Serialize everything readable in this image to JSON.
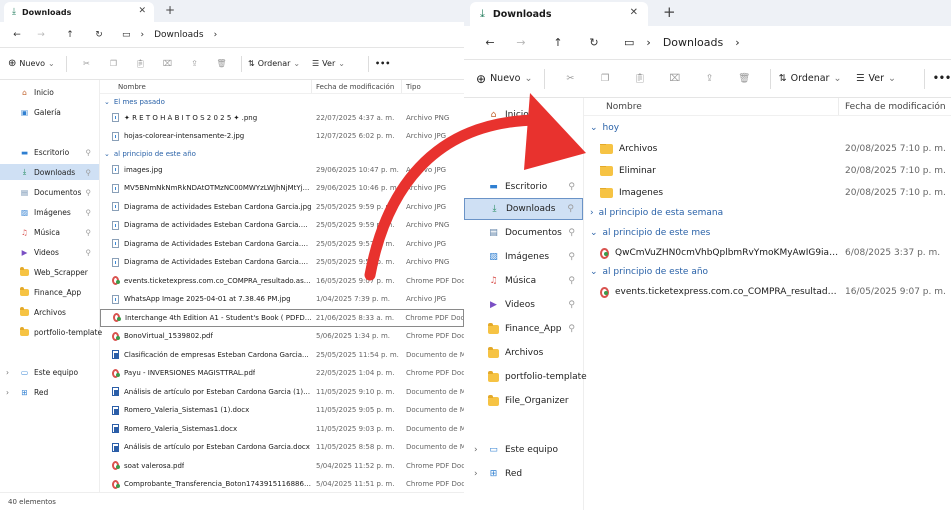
{
  "colors": {
    "accent": "#2a62a8",
    "selection": "#cfe0f4",
    "arrow": "#e8322e",
    "folder": "#f6c344"
  },
  "left": {
    "tab": {
      "title": "Downloads"
    },
    "breadcrumb": [
      "Downloads"
    ],
    "toolbar": {
      "new": "Nuevo",
      "sort": "Ordenar",
      "view": "Ver",
      "more": "•••"
    },
    "sidebar": [
      {
        "label": "Inicio",
        "icon": "home-icon"
      },
      {
        "label": "Galería",
        "icon": "gallery-icon"
      },
      {
        "label": "Escritorio",
        "icon": "desktop-icon",
        "pinned": true
      },
      {
        "label": "Downloads",
        "icon": "download-icon",
        "pinned": true,
        "selected": true
      },
      {
        "label": "Documentos",
        "icon": "documents-icon",
        "pinned": true
      },
      {
        "label": "Imágenes",
        "icon": "pictures-icon",
        "pinned": true
      },
      {
        "label": "Música",
        "icon": "music-icon",
        "pinned": true
      },
      {
        "label": "Videos",
        "icon": "videos-icon",
        "pinned": true
      },
      {
        "label": "Web_Scrapper",
        "icon": "folder-icon"
      },
      {
        "label": "Finance_App",
        "icon": "folder-icon"
      },
      {
        "label": "Archivos",
        "icon": "folder-icon"
      },
      {
        "label": "portfolio-template",
        "icon": "folder-icon"
      },
      {
        "label": "Este equipo",
        "icon": "computer-icon"
      },
      {
        "label": "Red",
        "icon": "network-icon"
      }
    ],
    "columns": {
      "name": "Nombre",
      "date": "Fecha de modificación",
      "type": "Tipo"
    },
    "groups": [
      {
        "label": "El mes pasado",
        "rows": [
          {
            "name": "✦ R E T O H Á B I T O S 2 0 2 5 ✦ .png",
            "date": "22/07/2025 4:37 a. m.",
            "type": "Archivo PNG",
            "kind": "img"
          },
          {
            "name": "hojas-colorear-intensamente-2.jpg",
            "date": "12/07/2025 6:02 p. m.",
            "type": "Archivo JPG",
            "kind": "img"
          }
        ]
      },
      {
        "label": "al principio de este año",
        "rows": [
          {
            "name": "images.jpg",
            "date": "29/06/2025 10:47 p. m.",
            "type": "Archivo JPG",
            "kind": "img"
          },
          {
            "name": "MV5BNmNkNmRkNDAtOTMzNC00MWYzLWJhNjMtYj...",
            "date": "29/06/2025 10:46 p. m.",
            "type": "Archivo JPG",
            "kind": "img"
          },
          {
            "name": "Diagrama de actividades Esteban Cardona Garcia.jpg",
            "date": "25/05/2025 9:59 p. m.",
            "type": "Archivo JPG",
            "kind": "img"
          },
          {
            "name": "Diagrama de actividades Esteban Cardona Garcia.drawio.png",
            "date": "25/05/2025 9:59 p. m.",
            "type": "Archivo PNG",
            "kind": "img"
          },
          {
            "name": "Diagrama de Actividades Esteban Cardona Garcia.drawio.jpg",
            "date": "25/05/2025 9:57 p. m.",
            "type": "Archivo JPG",
            "kind": "img"
          },
          {
            "name": "Diagrama de Actividades Esteban Cardona Garcia.drawio.png",
            "date": "25/05/2025 9:56 p. m.",
            "type": "Archivo PNG",
            "kind": "img"
          },
          {
            "name": "events.ticketexpress.com.co_COMPRA_resultado.aspx_...",
            "date": "16/05/2025 9:07 p. m.",
            "type": "Chrome PDF Document",
            "kind": "pdf"
          },
          {
            "name": "WhatsApp Image 2025-04-01 at 7.38.46 PM.jpg",
            "date": "1/04/2025 7:39 p. m.",
            "type": "Archivo JPG",
            "kind": "img"
          },
          {
            "name": "Interchange 4th Edition A1 - Student's Book ( PDFDriv...",
            "date": "21/06/2025 8:33 a. m.",
            "type": "Chrome PDF Document",
            "kind": "pdf",
            "selected": true
          },
          {
            "name": "BonoVirtual_1539802.pdf",
            "date": "5/06/2025 1:34 p. m.",
            "type": "Chrome PDF Document",
            "kind": "pdf"
          },
          {
            "name": "Clasificación de empresas Esteban Cardona Garcia...",
            "date": "25/05/2025 11:54 p. m.",
            "type": "Documento de Microsoft Word",
            "kind": "doc"
          },
          {
            "name": "Payu - INVERSIONES MAGISTTRAL.pdf",
            "date": "22/05/2025 1:04 p. m.",
            "type": "Chrome PDF Document",
            "kind": "pdf"
          },
          {
            "name": "Análisis de artículo por Esteban Cardona Garcia (1).do...",
            "date": "11/05/2025 9:10 p. m.",
            "type": "Documento de Microsoft Word",
            "kind": "doc"
          },
          {
            "name": "Romero_Valeria_Sistemas1 (1).docx",
            "date": "11/05/2025 9:05 p. m.",
            "type": "Documento de Microsoft Word",
            "kind": "doc"
          },
          {
            "name": "Romero_Valeria_Sistemas1.docx",
            "date": "11/05/2025 9:03 p. m.",
            "type": "Documento de Microsoft Word",
            "kind": "doc"
          },
          {
            "name": "Análisis de artículo por Esteban Cardona Garcia.docx",
            "date": "11/05/2025 8:58 p. m.",
            "type": "Documento de Microsoft Word",
            "kind": "doc"
          },
          {
            "name": "soat valerosa.pdf",
            "date": "5/04/2025 11:52 p. m.",
            "type": "Chrome PDF Document",
            "kind": "pdf"
          },
          {
            "name": "Comprobante_Transferencia_Boton1743915116886.pdf",
            "date": "5/04/2025 11:51 p. m.",
            "type": "Chrome PDF Document",
            "kind": "pdf"
          }
        ]
      }
    ],
    "status": "40 elementos"
  },
  "right": {
    "tab": {
      "title": "Downloads"
    },
    "breadcrumb": [
      "Downloads"
    ],
    "toolbar": {
      "new": "Nuevo",
      "sort": "Ordenar",
      "view": "Ver",
      "more": "•••"
    },
    "sidebar": [
      {
        "label": "Inicio",
        "icon": "home-icon"
      },
      {
        "label": "Escritorio",
        "icon": "desktop-icon",
        "pinned": true
      },
      {
        "label": "Downloads",
        "icon": "download-icon",
        "pinned": true,
        "selected": true
      },
      {
        "label": "Documentos",
        "icon": "documents-icon",
        "pinned": true
      },
      {
        "label": "Imágenes",
        "icon": "pictures-icon",
        "pinned": true
      },
      {
        "label": "Música",
        "icon": "music-icon",
        "pinned": true
      },
      {
        "label": "Videos",
        "icon": "videos-icon",
        "pinned": true
      },
      {
        "label": "Finance_App",
        "icon": "folder-icon",
        "pinned": true
      },
      {
        "label": "Archivos",
        "icon": "folder-icon"
      },
      {
        "label": "portfolio-template",
        "icon": "folder-icon"
      },
      {
        "label": "File_Organizer",
        "icon": "folder-icon"
      },
      {
        "label": "Este equipo",
        "icon": "computer-icon"
      },
      {
        "label": "Red",
        "icon": "network-icon"
      }
    ],
    "columns": {
      "name": "Nombre",
      "date": "Fecha de modificación"
    },
    "groups": [
      {
        "label": "hoy",
        "expanded": true,
        "rows": [
          {
            "name": "Archivos",
            "date": "20/08/2025 7:10 p. m.",
            "kind": "folder"
          },
          {
            "name": "Eliminar",
            "date": "20/08/2025 7:10 p. m.",
            "kind": "folder"
          },
          {
            "name": "Imagenes",
            "date": "20/08/2025 7:10 p. m.",
            "kind": "folder"
          }
        ]
      },
      {
        "label": "al principio de esta semana",
        "expanded": false,
        "rows": []
      },
      {
        "label": "al principio de este mes",
        "expanded": true,
        "rows": [
          {
            "name": "QwCmVuZHN0cmVhbQplbmRvYmoKMyAwIG9iajw8L0...",
            "date": "6/08/2025 3:37 p. m.",
            "kind": "pdf"
          }
        ]
      },
      {
        "label": "al principio de este año",
        "expanded": true,
        "rows": [
          {
            "name": "events.ticketexpress.com.co_COMPRA_resultado.aspx_...",
            "date": "16/05/2025 9:07 p. m.",
            "kind": "pdf"
          }
        ]
      }
    ]
  }
}
